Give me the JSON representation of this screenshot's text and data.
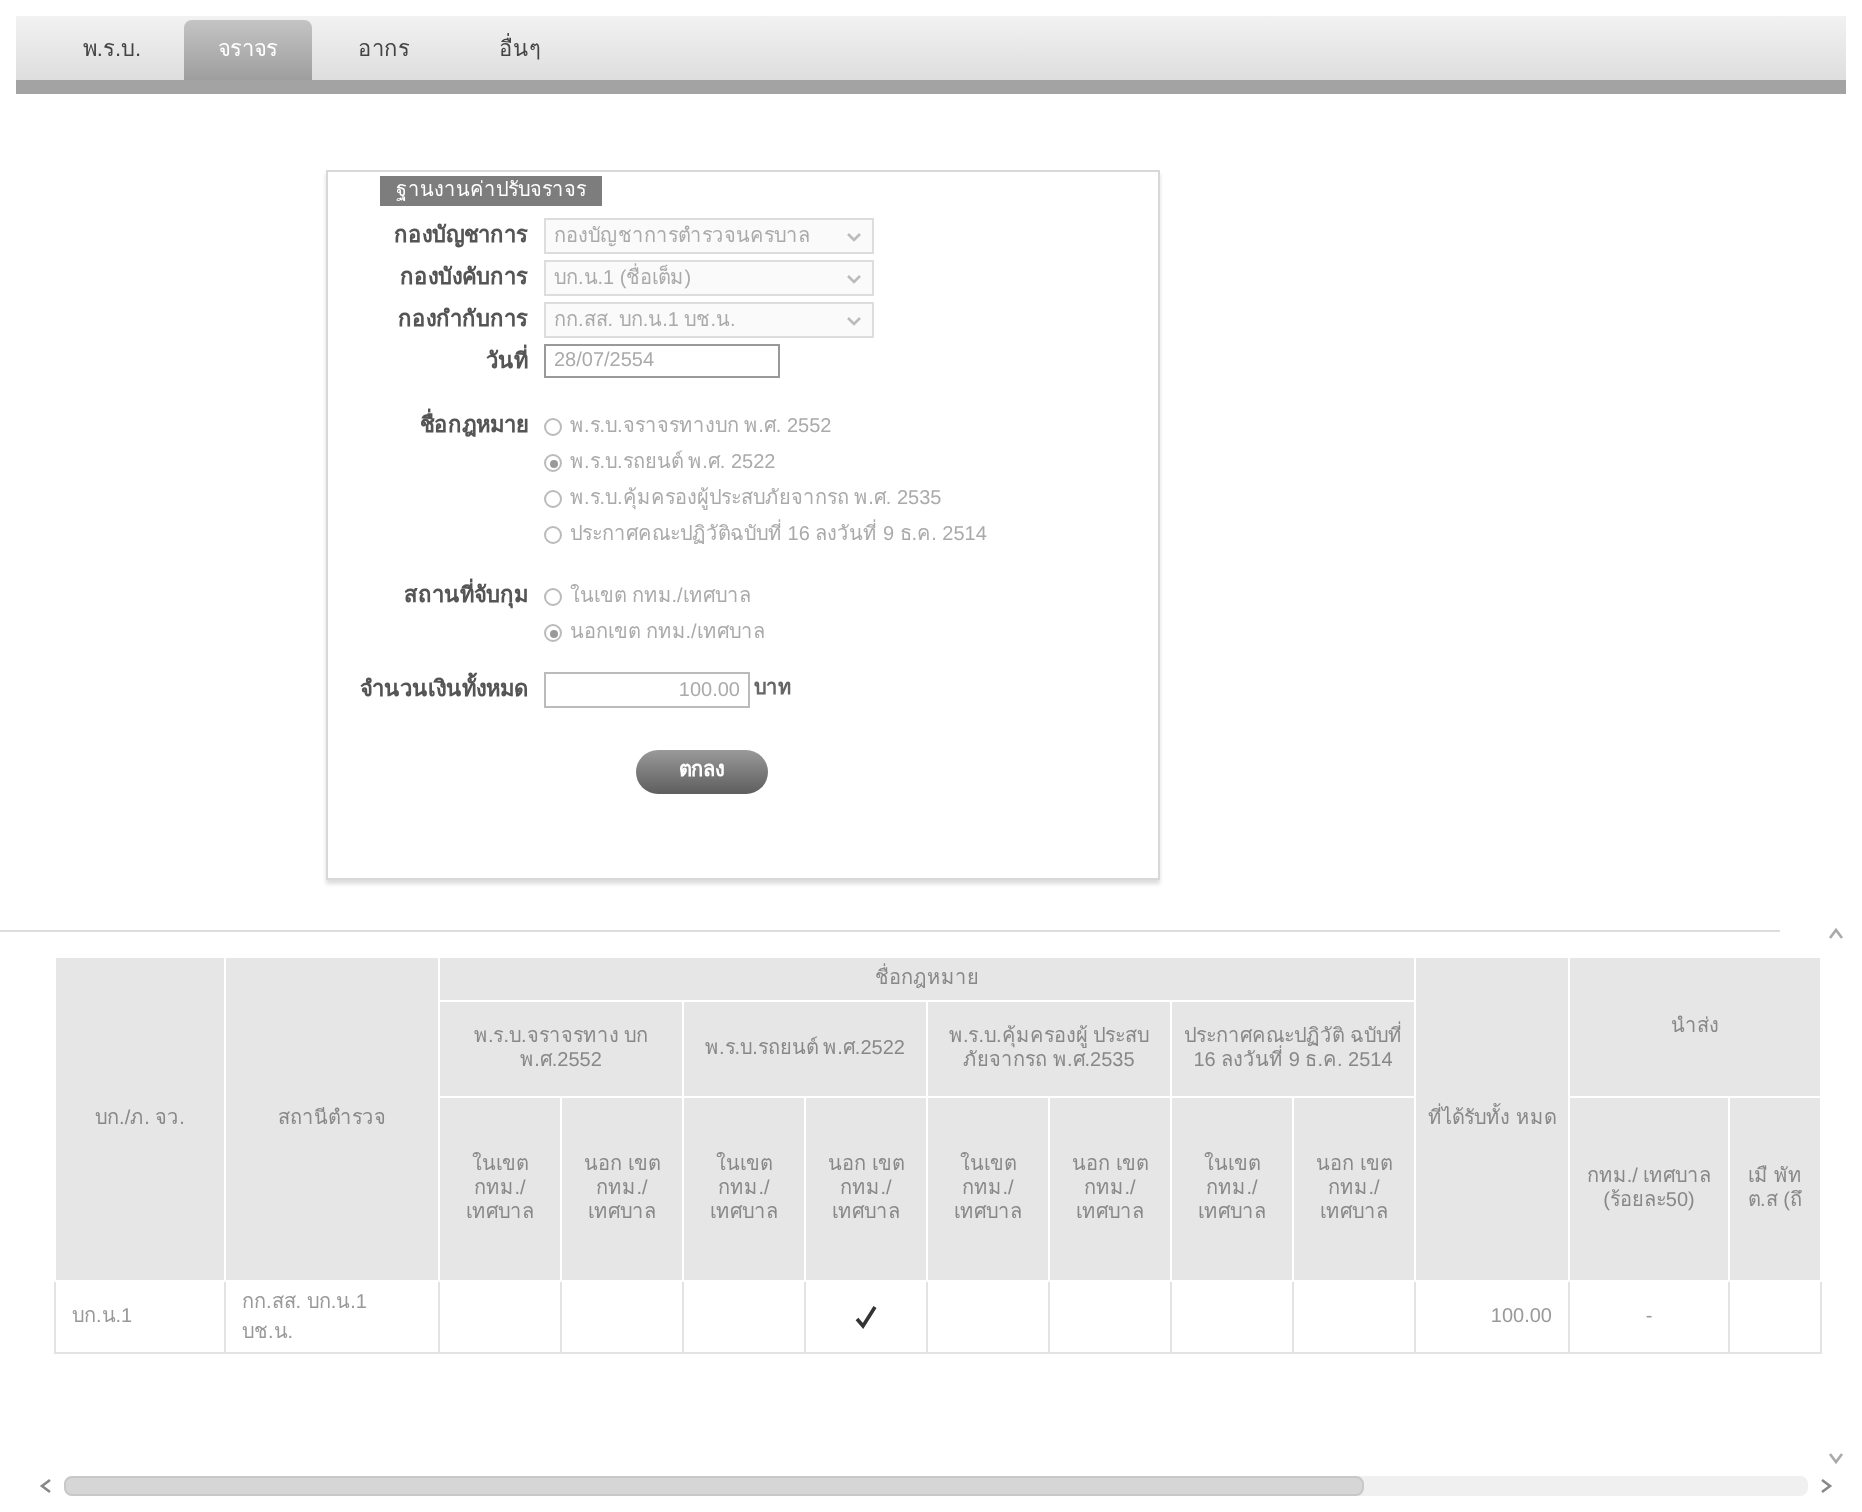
{
  "tabs": [
    {
      "label": "พ.ร.บ.",
      "selected": false
    },
    {
      "label": "จราจร",
      "selected": true
    },
    {
      "label": "อากร",
      "selected": false
    },
    {
      "label": "อื่นๆ",
      "selected": false
    }
  ],
  "form": {
    "title": "ฐานงานค่าปรับจราจร",
    "selects": [
      {
        "label": "กองบัญชาการ",
        "value": "กองบัญชาการตำรวจนครบาล"
      },
      {
        "label": "กองบังคับการ",
        "value": "บก.น.1 (ชื่อเต็ม)"
      },
      {
        "label": "กองกำกับการ",
        "value": "กก.สส. บก.น.1 บช.น."
      }
    ],
    "date": {
      "label": "วันที่",
      "value": "28/07/2554"
    },
    "radio_groups": [
      {
        "label": "ชื่อกฎหมาย",
        "options": [
          {
            "label": "พ.ร.บ.จราจรทางบก พ.ศ. 2552",
            "selected": false
          },
          {
            "label": "พ.ร.บ.รถยนต์ พ.ศ. 2522",
            "selected": true
          },
          {
            "label": "พ.ร.บ.คุ้มครองผู้ประสบภัยจากรถ พ.ศ. 2535",
            "selected": false
          },
          {
            "label": "ประกาศคณะปฏิวัติฉบับที่ 16 ลงวันที่ 9 ธ.ค. 2514",
            "selected": false
          }
        ]
      },
      {
        "label": "สถานที่จับกุม",
        "options": [
          {
            "label": "ในเขต กทม./เทศบาล",
            "selected": false
          },
          {
            "label": "นอกเขต กทม./เทศบาล",
            "selected": true
          }
        ]
      }
    ],
    "amount": {
      "label": "จำนวนเงินทั้งหมด",
      "value": "100.00",
      "unit": "บาท"
    },
    "button": "ตกลง"
  },
  "table": {
    "header_rows": [
      [
        {
          "text": "บก./ภ. จว.",
          "rowspan": 3
        },
        {
          "text": "สถานีตำรวจ",
          "rowspan": 3
        },
        {
          "text": "ชื่อกฎหมาย",
          "colspan": 8
        },
        {
          "text": "ที่ได้รับทั้ง หมด",
          "rowspan": 3
        },
        {
          "text": "นำส่ง",
          "rowspan": 2,
          "colspan": 2
        }
      ],
      [
        {
          "text": "พ.ร.บ.จราจรทาง บก พ.ศ.2552",
          "colspan": 2
        },
        {
          "text": "พ.ร.บ.รถยนต์ พ.ศ.2522",
          "colspan": 2
        },
        {
          "text": "พ.ร.บ.คุ้มครองผู้ ประสบภัยจากรถ พ.ศ.2535",
          "colspan": 2
        },
        {
          "text": "ประกาศคณะปฏิวัติ ฉบับที่ 16 ลงวันที่ 9 ธ.ค. 2514",
          "colspan": 2
        }
      ],
      [
        {
          "text": "ในเขต กทม./ เทศบาล"
        },
        {
          "text": "นอก เขต กทม./ เทศบาล"
        },
        {
          "text": "ในเขต กทม./ เทศบาล"
        },
        {
          "text": "นอก เขต กทม./ เทศบาล"
        },
        {
          "text": "ในเขต กทม./ เทศบาล"
        },
        {
          "text": "นอก เขต กทม./ เทศบาล"
        },
        {
          "text": "ในเขต กทม./ เทศบาล"
        },
        {
          "text": "นอก เขต กทม./ เทศบาล"
        },
        {
          "text": "กทม./ เทศบาล (ร้อยละ50)"
        },
        {
          "text": "เมื พัท ต.ส (ถึ"
        }
      ]
    ],
    "rows": [
      {
        "cells": [
          {
            "kind": "text",
            "text": "บก.น.1"
          },
          {
            "kind": "text",
            "text": "กก.สส. บก.น.1 บช.น."
          },
          {
            "kind": "check",
            "checked": false
          },
          {
            "kind": "check",
            "checked": false
          },
          {
            "kind": "check",
            "checked": false
          },
          {
            "kind": "check",
            "checked": true
          },
          {
            "kind": "check",
            "checked": false
          },
          {
            "kind": "check",
            "checked": false
          },
          {
            "kind": "check",
            "checked": false
          },
          {
            "kind": "check",
            "checked": false
          },
          {
            "kind": "number",
            "text": "100.00"
          },
          {
            "kind": "center",
            "text": "-"
          },
          {
            "kind": "empty"
          }
        ]
      }
    ]
  }
}
